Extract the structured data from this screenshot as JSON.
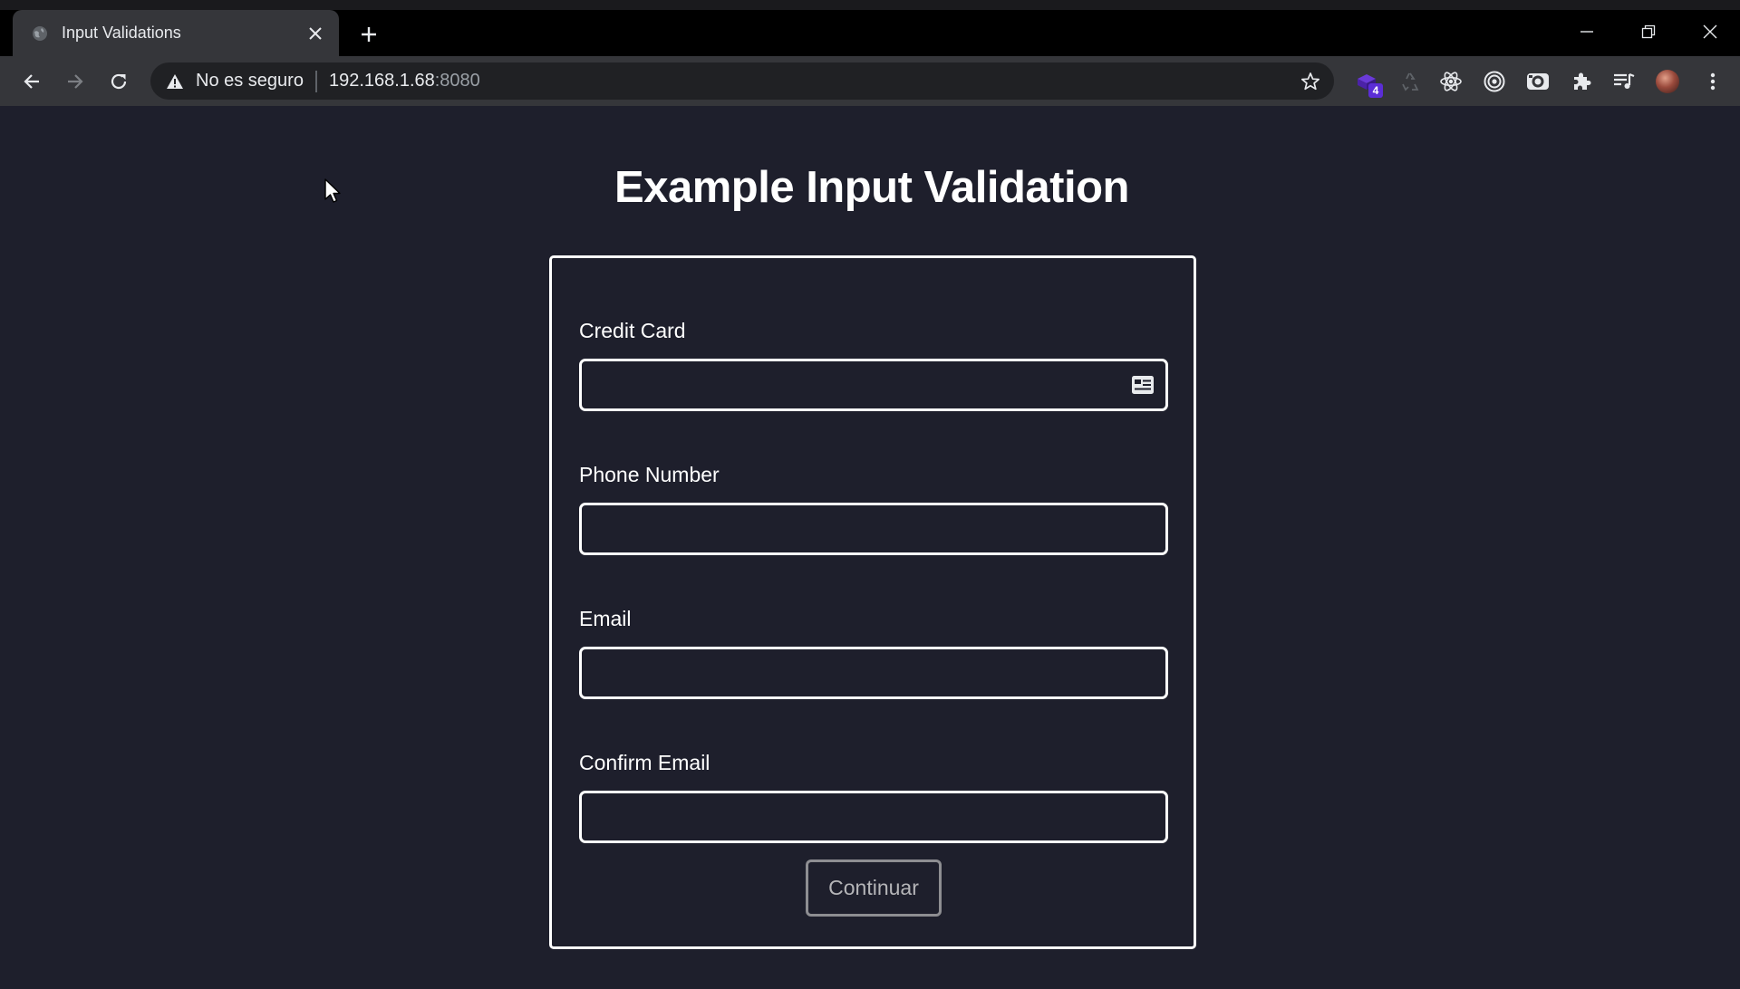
{
  "browser": {
    "tab": {
      "title": "Input Validations",
      "favicon": "globe-icon",
      "close": "close-icon"
    },
    "new_tab": "plus-icon",
    "window_controls": [
      "minimize-icon",
      "restore-icon",
      "close-icon"
    ],
    "nav": {
      "back": "arrow-left-icon",
      "forward": "arrow-right-icon",
      "reload": "reload-icon"
    },
    "address_bar": {
      "security_icon": "warning-icon",
      "security_text": "No es seguro",
      "host": "192.168.1.68",
      "port": ":8080",
      "bookmark": "star-icon"
    },
    "extensions": [
      {
        "name": "ext-purple-icon",
        "badge": "4"
      },
      {
        "name": "recycle-icon"
      },
      {
        "name": "react-icon"
      },
      {
        "name": "target-icon"
      },
      {
        "name": "camera-ext-icon"
      },
      {
        "name": "puzzle-icon"
      },
      {
        "name": "playlist-icon"
      },
      {
        "name": "profile-avatar"
      },
      {
        "name": "menu-dots-icon"
      }
    ]
  },
  "page": {
    "title": "Example Input Validation",
    "form": {
      "credit_card": {
        "label": "Credit Card",
        "value": "",
        "icon": "contact-card-icon"
      },
      "phone": {
        "label": "Phone Number",
        "value": ""
      },
      "email": {
        "label": "Email",
        "value": ""
      },
      "confirm_email": {
        "label": "Confirm Email",
        "value": ""
      },
      "submit_label": "Continuar"
    }
  },
  "colors": {
    "page_bg": "#1e1f2c",
    "chrome_toolbar": "#35363a",
    "omnibox_bg": "#202124",
    "border": "#ffffff",
    "button_border": "#8e8e92",
    "badge": "#5b2dd6"
  }
}
